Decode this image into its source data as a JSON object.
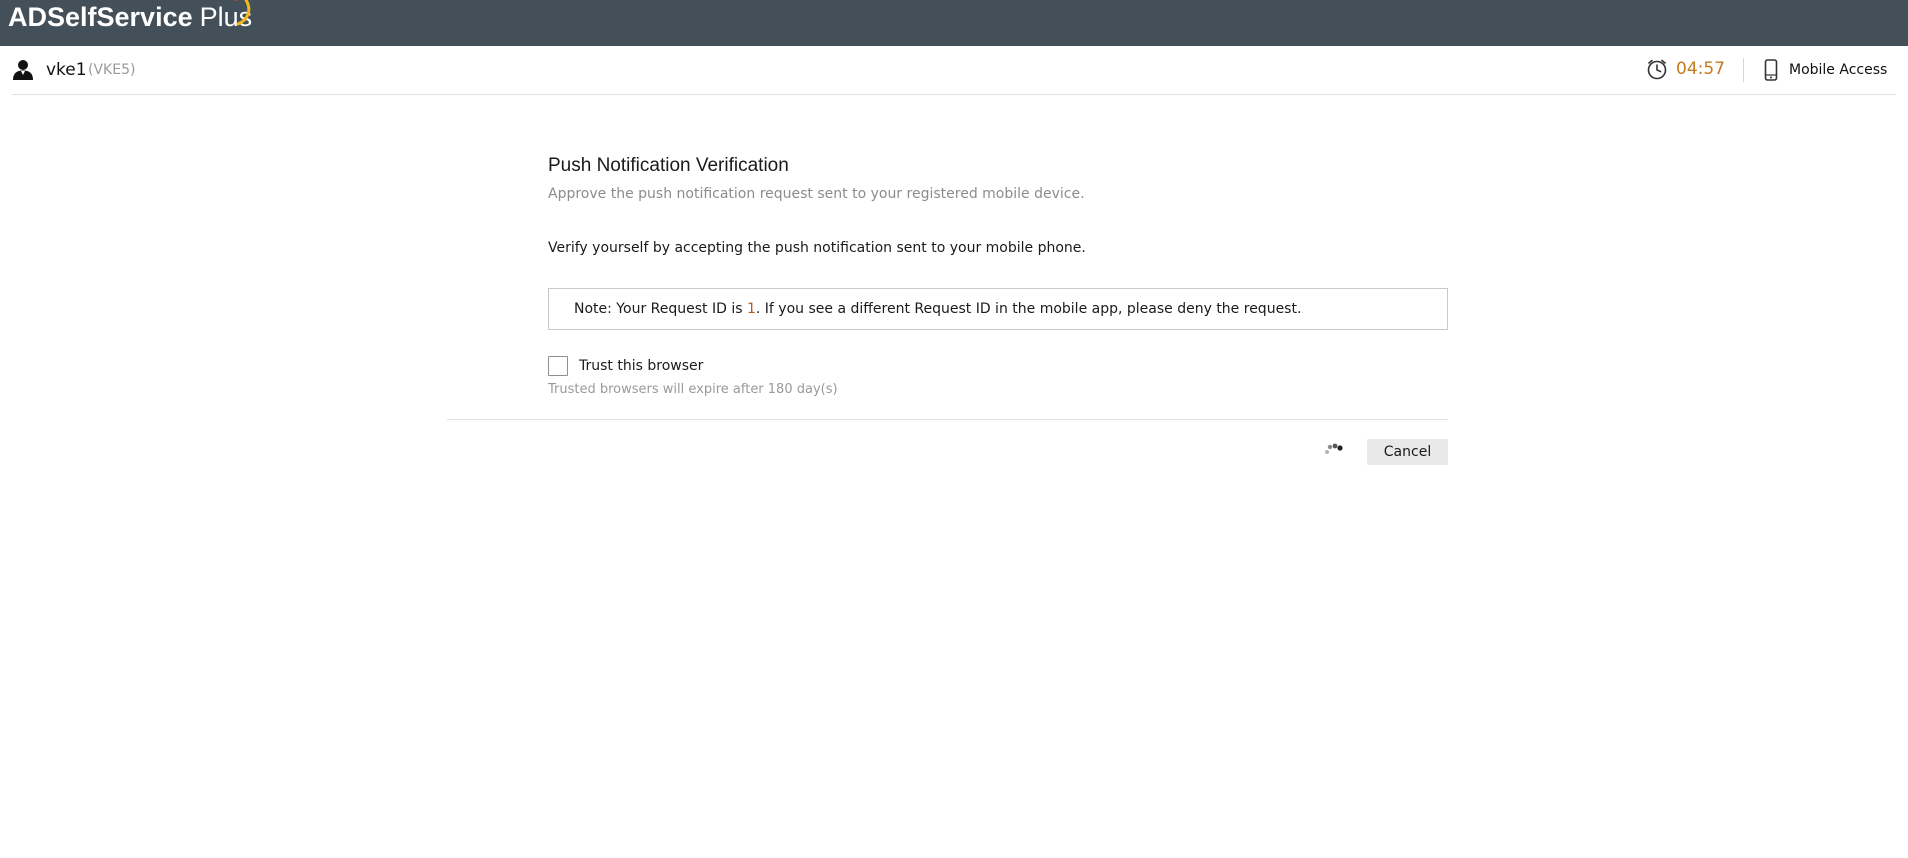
{
  "header": {
    "brand": "ADSelfService",
    "brand_suffix": "Plus",
    "colors": {
      "bar": "#434f59",
      "swoosh": "#f2b81b",
      "swoosh_accent": "#d8432b"
    }
  },
  "user": {
    "icon": "user-icon",
    "name": "vke1",
    "id": "(VKE5)"
  },
  "session": {
    "timer_icon": "clock-icon",
    "timer": "04:57",
    "timer_color": "#c57a1e",
    "mobile_icon": "mobile-phone-icon",
    "mobile_label": "Mobile Access"
  },
  "panel": {
    "title": "Push Notification Verification",
    "subtitle": "Approve the push notification request sent to your registered mobile device.",
    "instruction": "Verify yourself by accepting the push notification sent to your mobile phone.",
    "note_prefix": "Note: Your Request ID is ",
    "request_id": "1",
    "note_suffix": ". If you see a different Request ID in the mobile app, please deny the request.",
    "trust_label": "Trust this browser",
    "trust_checked": false,
    "trust_hint": "Trusted browsers will expire after 180 day(s)",
    "spinner_icon": "loading-spinner-icon",
    "cancel_label": "Cancel"
  }
}
